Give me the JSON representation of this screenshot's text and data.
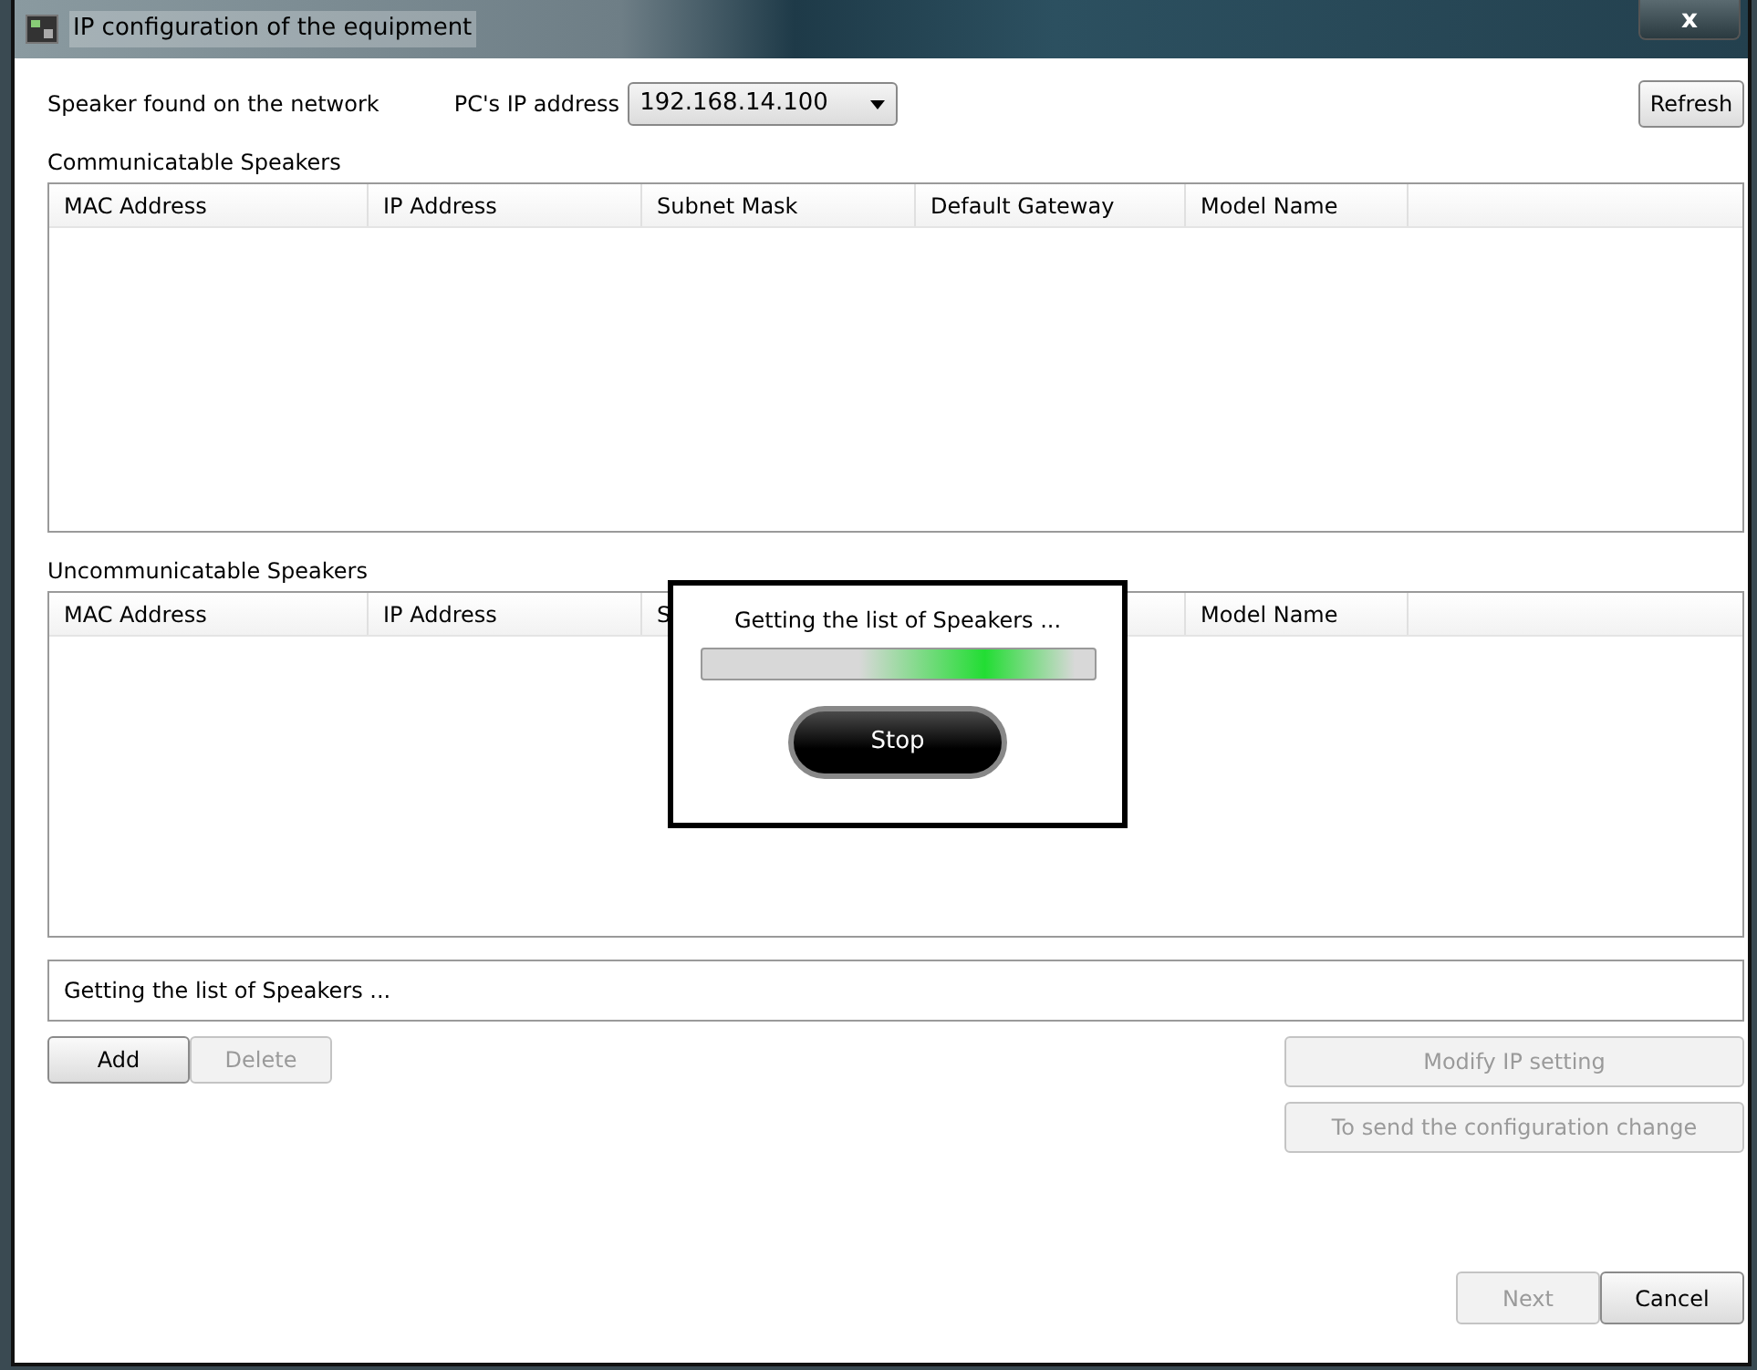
{
  "window": {
    "title": "IP configuration of the equipment",
    "close": "x"
  },
  "toolbar": {
    "found_label": "Speaker found on the network",
    "ip_label": "PC's IP address",
    "ip_value": "192.168.14.100",
    "refresh": "Refresh"
  },
  "communicatable": {
    "title": "Communicatable Speakers",
    "columns": [
      {
        "label": "MAC Address"
      },
      {
        "label": "IP Address"
      },
      {
        "label": "Subnet Mask"
      },
      {
        "label": "Default Gateway"
      },
      {
        "label": "Model Name"
      }
    ]
  },
  "uncommunicatable": {
    "title": "Uncommunicatable Speakers",
    "columns": [
      {
        "label": "MAC Address"
      },
      {
        "label": "IP Address"
      },
      {
        "label": "S"
      },
      {},
      {
        "label": "Model Name"
      }
    ]
  },
  "status": "Getting the list of Speakers ...",
  "left_buttons": [
    {
      "label": "Add",
      "disabled": false
    },
    {
      "label": "Delete",
      "disabled": true
    }
  ],
  "right_buttons": [
    {
      "label": "Modify IP setting",
      "disabled": true
    },
    {
      "label": "To send the configuration change",
      "disabled": true
    }
  ],
  "footer_buttons": [
    {
      "label": "Next",
      "disabled": true
    },
    {
      "label": "Cancel",
      "disabled": false
    }
  ],
  "progress_dialog": {
    "message": "Getting the list of Speakers ...",
    "indeterminate": true,
    "button": "Stop"
  }
}
